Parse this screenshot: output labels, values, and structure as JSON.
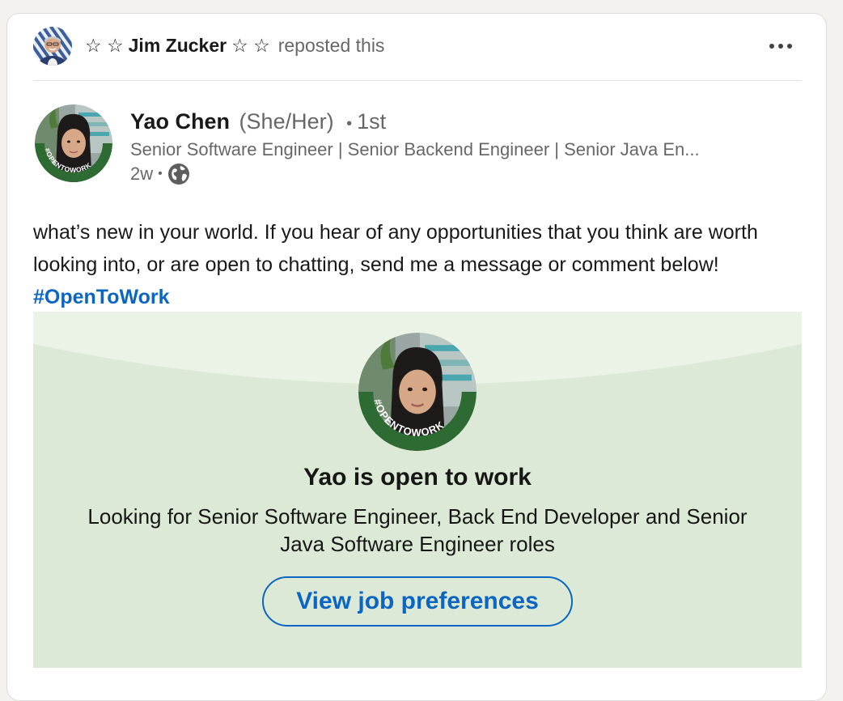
{
  "repost": {
    "stars_left": "☆ ☆",
    "name": "Jim Zucker",
    "stars_right": "☆ ☆",
    "verb": "reposted this",
    "more_icon": "ellipsis-icon"
  },
  "author": {
    "name": "Yao Chen",
    "pronouns": "(She/Her)",
    "separator": "•",
    "degree": "1st",
    "headline": "Senior Software Engineer | Senior Backend Engineer | Senior Java En...",
    "time": "2w",
    "visibility_icon": "globe-icon",
    "frame_text": "#OPENTOWORK"
  },
  "post": {
    "text": "what’s new in your world. If you hear of any opportunities that you think are worth looking into, or are open to chatting, send me a message or comment below! ",
    "hashtag": "#OpenToWork"
  },
  "open_to_work": {
    "frame_text": "#OPENTOWORK",
    "title": "Yao is open to work",
    "description": "Looking for Senior Software Engineer, Back End Developer and Senior Java Software Engineer roles",
    "button_label": "View job preferences"
  },
  "colors": {
    "link_blue": "#0a66c2",
    "otw_green": "#2e6b32",
    "banner_light": "#eaf3e6",
    "banner_dark": "#dce9d6"
  }
}
